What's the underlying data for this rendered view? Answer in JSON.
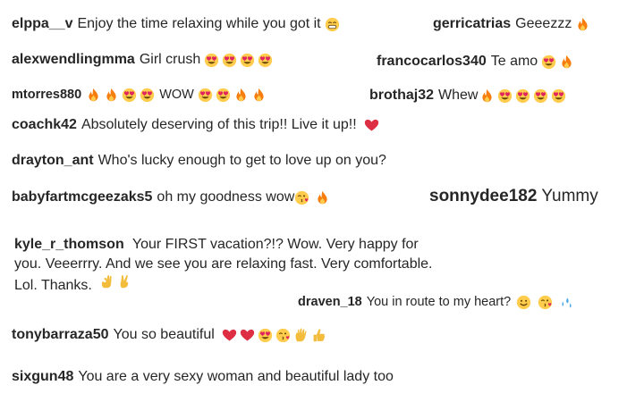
{
  "comments": [
    {
      "user": "elppa__v",
      "text": "Enjoy the time relaxing while you got it",
      "emojis": [
        "grin-emoji"
      ]
    },
    {
      "user": "gerricatrias",
      "text": "Geeezzz",
      "emojis": [
        "fire-emoji"
      ]
    },
    {
      "user": "alexwendlingmma",
      "text": "Girl crush",
      "emojis": [
        "heart-eyes-emoji",
        "heart-eyes-emoji",
        "heart-eyes-emoji",
        "heart-eyes-emoji"
      ]
    },
    {
      "user": "francocarlos340",
      "text": "Te amo",
      "emojis": [
        "heart-eyes-emoji",
        "fire-emoji"
      ]
    },
    {
      "user": "mtorres880",
      "text": "WOW",
      "emojis_before": [
        "fire-emoji",
        "fire-emoji",
        "heart-eyes-emoji",
        "heart-eyes-emoji"
      ],
      "emojis": [
        "heart-eyes-emoji",
        "heart-eyes-emoji",
        "fire-emoji",
        "fire-emoji"
      ]
    },
    {
      "user": "brothaj32",
      "text": "Whew",
      "emojis": [
        "fire-emoji",
        "heart-eyes-emoji",
        "heart-eyes-emoji",
        "heart-eyes-emoji",
        "heart-eyes-emoji"
      ]
    },
    {
      "user": "coachk42",
      "text": "Absolutely deserving of this trip!! Live it up!!",
      "emojis": [
        "red-heart-emoji"
      ]
    },
    {
      "user": "drayton_ant",
      "text": "Who's lucky enough to get to love up on you?",
      "emojis": []
    },
    {
      "user": "babyfartmcgeezaks5",
      "text": "oh my goodness wow",
      "emojis": [
        "kiss-emoji",
        "fire-emoji"
      ]
    },
    {
      "user": "sonnydee182",
      "text": "Yummy",
      "emojis": []
    },
    {
      "user": "kyle_r_thomson",
      "text": "Your FIRST vacation?!? Wow. Very happy for you. Veeerrry. And we see you are relaxing fast. Very comfortable. Lol. Thanks.",
      "emojis": [
        "ok-hand-emoji",
        "victory-hand-emoji"
      ]
    },
    {
      "user": "draven_18",
      "text": "You in route to my heart?",
      "emojis": [
        "smile-emoji",
        "kiss-emoji",
        "sweat-droplets-emoji"
      ]
    },
    {
      "user": "tonybarraza50",
      "text": "You so beautiful",
      "emojis": [
        "red-heart-emoji",
        "red-heart-emoji",
        "heart-eyes-emoji",
        "kiss-emoji",
        "raised-hand-emoji",
        "thumbs-up-emoji"
      ]
    },
    {
      "user": "sixgun48",
      "text": "You are a very sexy woman and beautiful lady too",
      "emojis": []
    }
  ],
  "colors": {
    "text": "#262626",
    "fire": "#f77d0f",
    "heart": "#e0245e",
    "face": "#ffcc4d",
    "hand": "#f3bc3b",
    "droplet": "#4aa8e8"
  }
}
